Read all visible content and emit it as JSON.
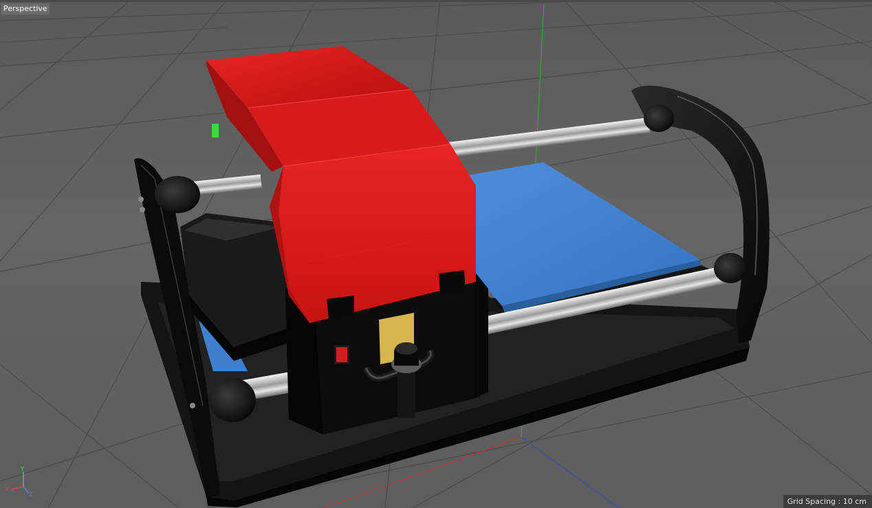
{
  "viewport": {
    "view_name": "Perspective",
    "grid_spacing": "Grid Spacing : 10 cm"
  },
  "axis_gizmo": {
    "x_label": "X",
    "y_label": "Y",
    "z_label": "Z"
  },
  "colors": {
    "background": "#5f5f5f",
    "grid_line": "#4b4b4b",
    "axis_y": "#3aa33a",
    "axis_x": "#b03a3a",
    "axis_z": "#3a4fb0",
    "housing_red": "#d61c1c",
    "platen_blue": "#3f7fcf",
    "frame_black": "#0d0d0d",
    "chrome": "#d4d4d4",
    "label_plate": "#d7b54d",
    "power_switch": "#d11d1d"
  },
  "scene_objects": {
    "model": "heat-press-machine"
  }
}
